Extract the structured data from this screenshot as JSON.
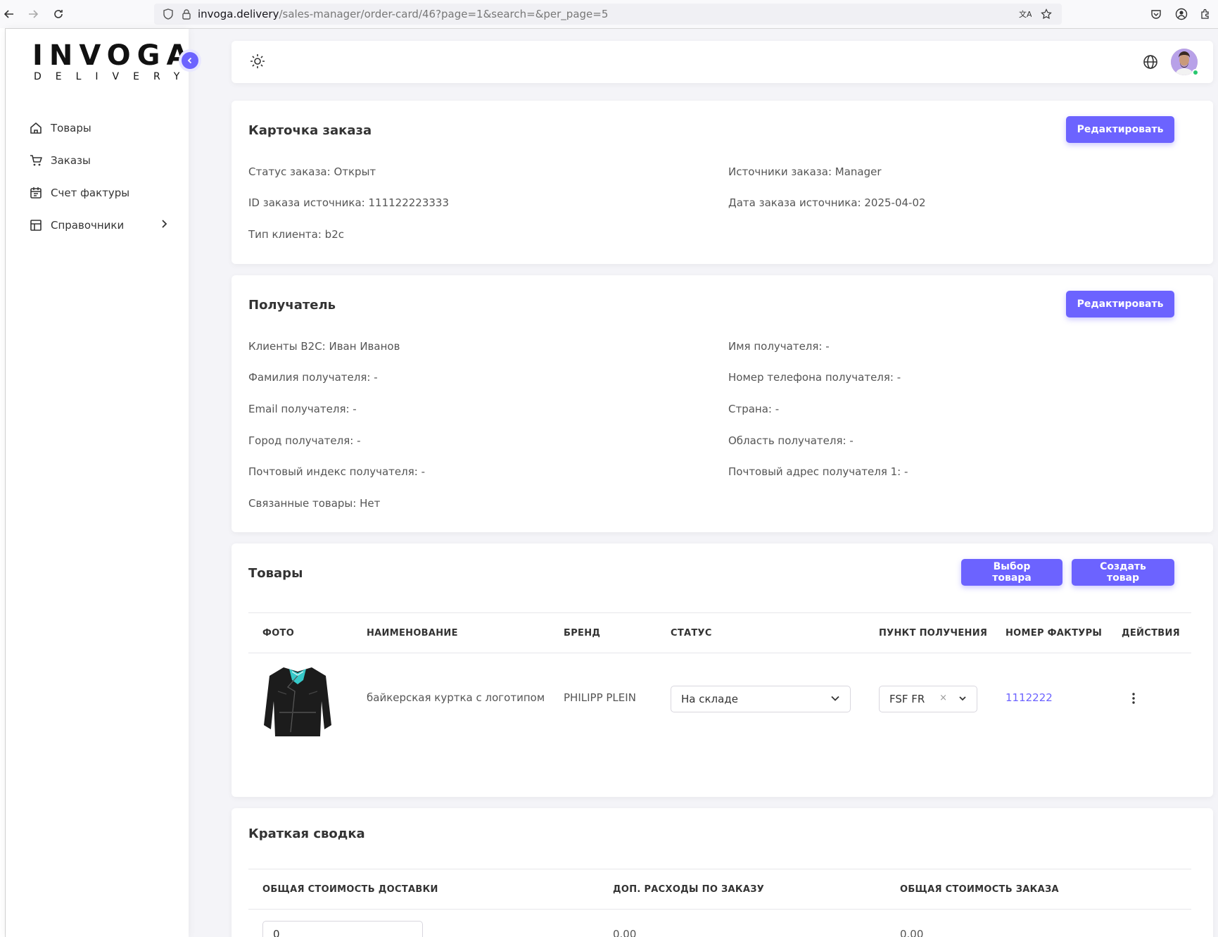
{
  "browser": {
    "url_host": "invoga.delivery",
    "url_path": "/sales-manager/order-card/46?page=1&search=&per_page=5"
  },
  "sidebar": {
    "logo_main": "INVOGA",
    "logo_sub": "DELIVERY",
    "items": [
      {
        "label": "Товары",
        "icon": "home-icon"
      },
      {
        "label": "Заказы",
        "icon": "cart-icon"
      },
      {
        "label": "Счет фактуры",
        "icon": "calendar-icon"
      },
      {
        "label": "Справочники",
        "icon": "layout-icon"
      }
    ]
  },
  "order_card": {
    "title": "Карточка заказа",
    "edit_label": "Редактировать",
    "status": "Статус заказа: Открыт",
    "sources": "Источники заказа: Manager",
    "source_id": "ID заказа источника: 111122223333",
    "source_date": "Дата заказа источника: 2025-04-02",
    "client_type": "Тип клиента: b2c"
  },
  "recipient": {
    "title": "Получатель",
    "edit_label": "Редактировать",
    "client_b2c": "Клиенты B2C: Иван Иванов",
    "name": "Имя получателя: -",
    "surname": "Фамилия получателя: -",
    "phone": "Номер телефона получателя: -",
    "email": "Email получателя: -",
    "country": "Страна: -",
    "city": "Город получателя: -",
    "region": "Область получателя: -",
    "postal": "Почтовый индекс получателя: -",
    "address1": "Почтовый адрес получателя 1: -",
    "linked": "Связанные товары: Нет"
  },
  "products": {
    "title": "Товары",
    "choose_label": "Выбор товара",
    "create_label": "Создать товар",
    "columns": [
      "ФОТО",
      "НАИМЕНОВАНИЕ",
      "БРЕНД",
      "СТАТУС",
      "ПУНКТ ПОЛУЧЕНИЯ",
      "НОМЕР ФАКТУРЫ",
      "ДЕЙСТВИЯ"
    ],
    "rows": [
      {
        "name": "байкерская куртка с логотипом",
        "brand": "PHILIPP PLEIN",
        "status": "На складе",
        "pickup": "FSF FR",
        "invoice": "1112222"
      }
    ]
  },
  "summary": {
    "title": "Краткая сводка",
    "columns": [
      "ОБЩАЯ СТОИМОСТЬ ДОСТАВКИ",
      "ДОП. РАСХОДЫ ПО ЗАКАЗУ",
      "ОБЩАЯ СТОИМОСТЬ ЗАКАЗА"
    ],
    "delivery_value": "0",
    "extra_costs": "0.00",
    "total": "0.00"
  },
  "colors": {
    "accent": "#6c63ff",
    "background": "#f4f4f8",
    "online": "#28c76f"
  }
}
